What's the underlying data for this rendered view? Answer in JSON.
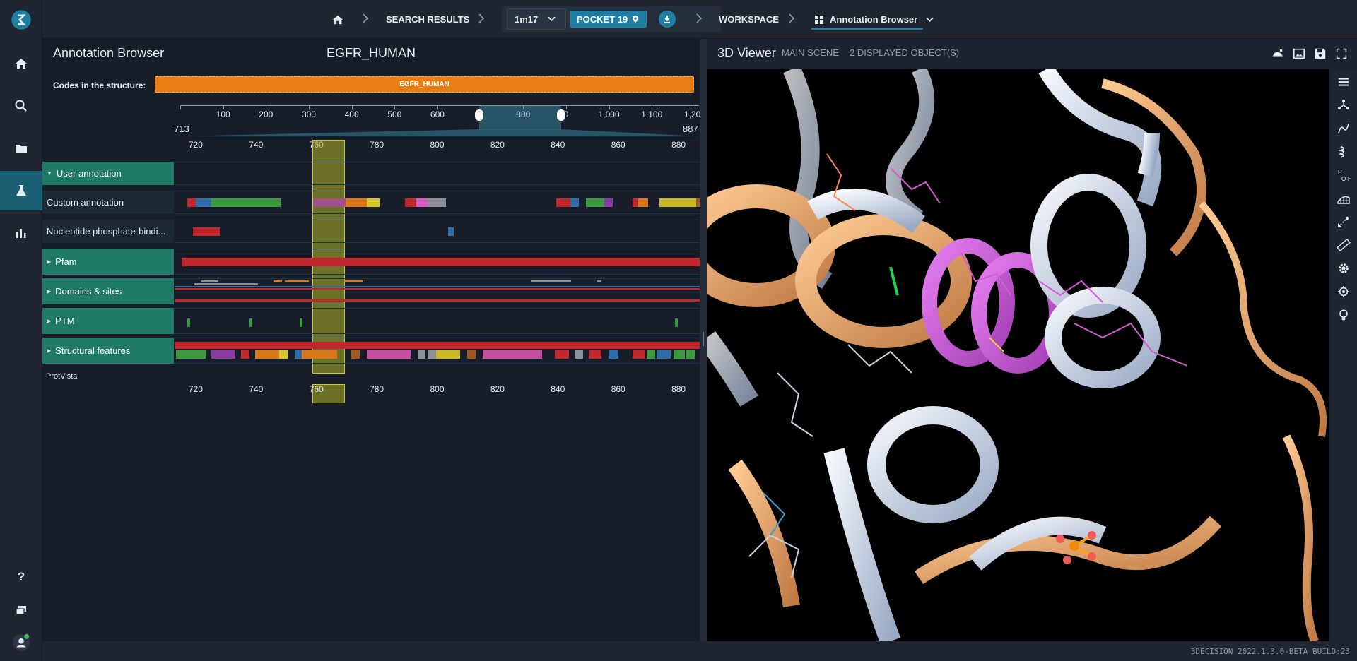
{
  "nav": {
    "rail": [
      "home-icon",
      "search-icon",
      "folder-icon",
      "flask-icon",
      "chart-icon",
      "help-icon",
      "windows-icon",
      "user-icon"
    ],
    "crumbs": {
      "search_results": "SEARCH RESULTS",
      "structure_id": "1m17",
      "pocket": "POCKET 19",
      "workspace": "WORKSPACE",
      "current_view": "Annotation Browser"
    }
  },
  "annotation_browser": {
    "title": "Annotation Browser",
    "protein": "EGFR_HUMAN",
    "codes_label": "Codes in the structure:",
    "codes": [
      "EGFR_HUMAN"
    ],
    "navigator_ticks": [
      "100",
      "200",
      "300",
      "400",
      "500",
      "600",
      "700",
      "800",
      "900",
      "1,000",
      "1,100",
      "1,200"
    ],
    "navigator_visible_ticks": [
      "100",
      "200",
      "300",
      "400",
      "500",
      "600",
      "7",
      "800",
      "0",
      "1,000",
      "1,100",
      "1,200"
    ],
    "zoom_start": "713",
    "zoom_end": "887",
    "position_ticks": [
      "720",
      "740",
      "760",
      "780",
      "800",
      "820",
      "840",
      "860",
      "880"
    ],
    "highlight_position": "760",
    "tracks": [
      {
        "label": "User annotation",
        "type": "category",
        "expanded": true
      },
      {
        "label": "Custom annotation",
        "type": "sub"
      },
      {
        "label": "Nucleotide phosphate-bindi...",
        "type": "sub"
      },
      {
        "label": "Pfam",
        "type": "category",
        "expanded": false
      },
      {
        "label": "Domains & sites",
        "type": "category",
        "expanded": false
      },
      {
        "label": "PTM",
        "type": "category",
        "expanded": false
      },
      {
        "label": "Structural features",
        "type": "category",
        "expanded": false
      }
    ],
    "footer_label": "ProtVista"
  },
  "viewer": {
    "title": "3D Viewer",
    "scene": "MAIN SCENE",
    "objects": "2 DISPLAYED OBJECT(S)",
    "tools": [
      "surface-icon",
      "image-icon",
      "save-icon",
      "fullscreen-icon"
    ],
    "side_tools": [
      "menu-icon",
      "molecule-icon",
      "ribbon-icon",
      "helix-icon",
      "hydrogen-icon",
      "mesh-icon",
      "measure-icon",
      "ruler-icon",
      "gear-icon",
      "target-icon",
      "bulb-icon"
    ]
  },
  "footer": {
    "build": "3DECISION 2022.1.3.0-BETA BUILD:23"
  },
  "colors": {
    "accent": "#1e7fa3",
    "category_track": "#1f7a66",
    "codes_bar": "#e67e12",
    "highlight": "#b4b428"
  }
}
